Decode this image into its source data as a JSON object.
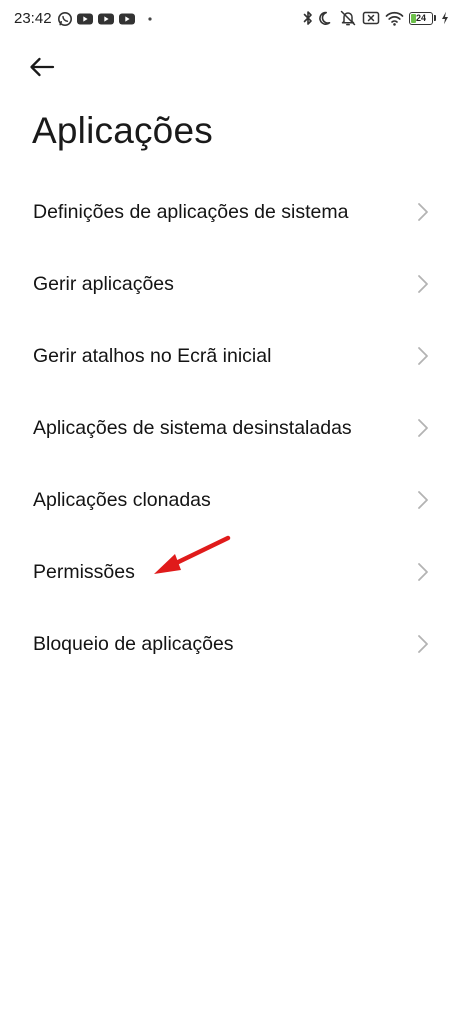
{
  "status_bar": {
    "time": "23:42",
    "battery_level": "24",
    "battery_fraction": 0.24,
    "left_icons": [
      "whatsapp-icon",
      "youtube-icon",
      "youtube-icon",
      "youtube-icon",
      "dot-icon"
    ],
    "right_icons": [
      "bluetooth-icon",
      "moon-icon",
      "muted-bell-icon",
      "sim-icon",
      "wifi-icon",
      "battery-icon",
      "charging-icon"
    ],
    "battery_color": "#6cc04a"
  },
  "header": {
    "back_icon": "arrow-left-icon",
    "title": "Aplicações"
  },
  "menu": {
    "items": [
      {
        "label": "Definições de aplicações de sistema"
      },
      {
        "label": "Gerir aplicações"
      },
      {
        "label": "Gerir atalhos no Ecrã inicial"
      },
      {
        "label": "Aplicações de sistema desinstaladas"
      },
      {
        "label": "Aplicações clonadas"
      },
      {
        "label": "Permissões"
      },
      {
        "label": "Bloqueio de aplicações"
      }
    ],
    "chevron_icon": "chevron-right-icon"
  },
  "annotation": {
    "icon": "red-arrow-icon",
    "color": "#e01b1b",
    "target": "Permissões"
  }
}
